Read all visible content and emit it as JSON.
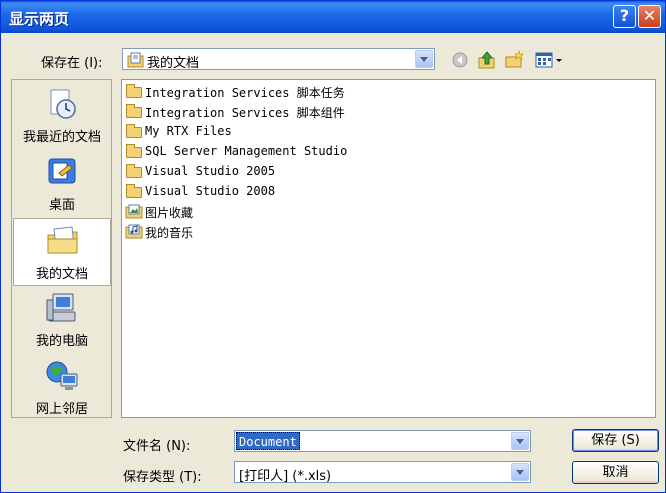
{
  "window": {
    "title": "显示两页"
  },
  "lookin": {
    "label": "保存在 (I):",
    "value": "我的文档",
    "icon": "my-documents-icon"
  },
  "places": [
    {
      "label": "我最近的文档",
      "icon": "recent-documents-icon",
      "selected": false
    },
    {
      "label": "桌面",
      "icon": "desktop-icon",
      "selected": false
    },
    {
      "label": "我的文档",
      "icon": "my-documents-icon",
      "selected": true
    },
    {
      "label": "我的电脑",
      "icon": "my-computer-icon",
      "selected": false
    },
    {
      "label": "网上邻居",
      "icon": "network-places-icon",
      "selected": false
    }
  ],
  "files": [
    {
      "name": "Integration Services 脚本任务",
      "icon": "folder-icon"
    },
    {
      "name": "Integration Services 脚本组件",
      "icon": "folder-icon"
    },
    {
      "name": "My RTX Files",
      "icon": "folder-icon"
    },
    {
      "name": "SQL Server Management Studio",
      "icon": "folder-icon"
    },
    {
      "name": "Visual Studio 2005",
      "icon": "folder-icon"
    },
    {
      "name": "Visual Studio 2008",
      "icon": "folder-icon"
    },
    {
      "name": "图片收藏",
      "icon": "picture-folder-icon"
    },
    {
      "name": "我的音乐",
      "icon": "music-folder-icon"
    }
  ],
  "filename": {
    "label": "文件名 (N):",
    "value": "Document"
  },
  "filetype": {
    "label": "保存类型 (T):",
    "value": "[打印人] (*.xls)"
  },
  "buttons": {
    "save": "保存 (S)",
    "cancel": "取消"
  },
  "colors": {
    "title_bar": "#0c56d9",
    "selection": "#316ac5",
    "window_bg": "#ece9d8"
  }
}
